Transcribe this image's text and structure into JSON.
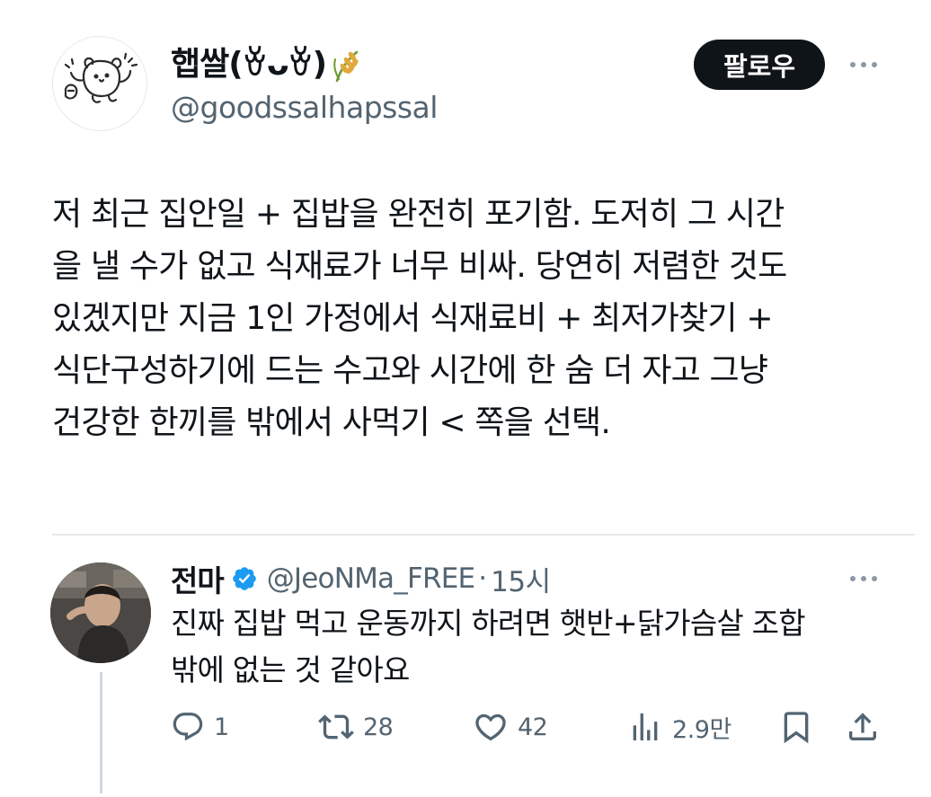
{
  "tweet": {
    "author_name": "햅쌀(ꈊᴗꈊ)",
    "author_handle": "@goodssalhapssal",
    "follow_label": "팔로우",
    "body_lines": [
      "저 최근 집안일 + 집밥을 완전히 포기함. 도저히 그 시간",
      "을 낼 수가 없고 식재료가 너무 비싸. 당연히 저렴한 것도",
      "있겠지만 지금 1인 가정에서 식재료비 + 최저가찾기 +",
      "식단구성하기에 드는 수고와 시간에 한 숨 더 자고 그냥",
      "건강한 한끼를 밖에서 사먹기 < 쪽을 선택."
    ]
  },
  "reply": {
    "author_name": "전마",
    "author_handle": "@JeoNMa_FREE",
    "separator": "·",
    "time": "15시",
    "body_lines": [
      "진짜 집밥 먹고 운동까지 하려면 햇반+닭가슴살 조합",
      "밖에 없는 것 같아요"
    ],
    "actions": {
      "reply_count": "1",
      "retweet_count": "28",
      "like_count": "42",
      "view_count": "2.9만"
    }
  },
  "icons": {
    "main_avatar": "bear-avatar-icon",
    "emoji": "rice-stalk-icon",
    "verified": "verified-badge-icon",
    "more": "more-icon",
    "reply": "reply-icon",
    "retweet": "retweet-icon",
    "like": "heart-icon",
    "views": "views-icon",
    "bookmark": "bookmark-icon",
    "share": "share-icon"
  },
  "colors": {
    "text_primary": "#0f1419",
    "text_secondary": "#536471",
    "verified_blue": "#1d9bf0",
    "follow_button_bg": "#0f1419",
    "divider": "#e6e8ea"
  }
}
